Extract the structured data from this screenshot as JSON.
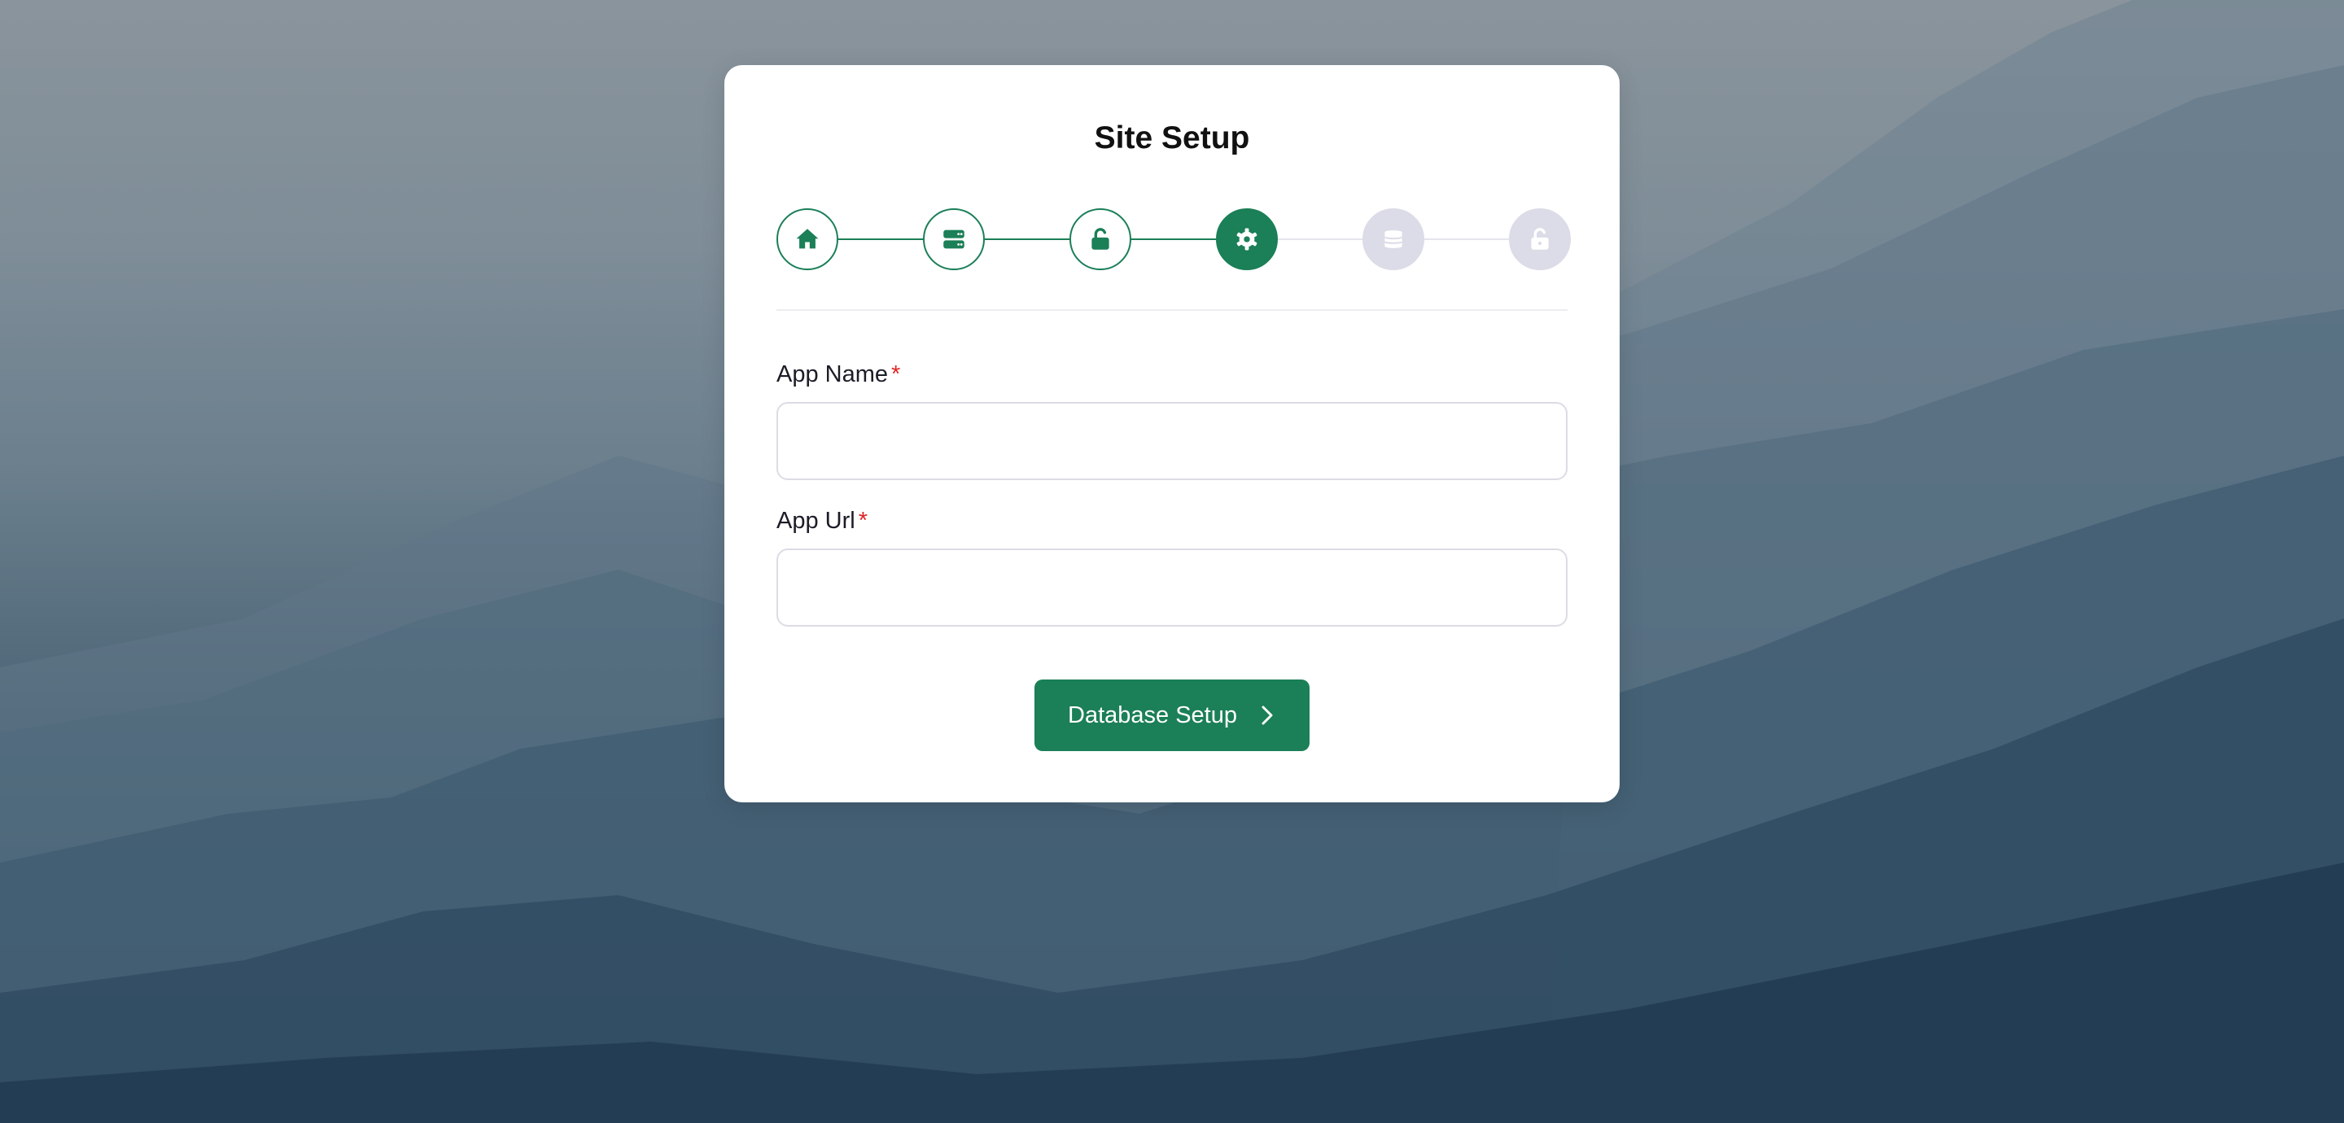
{
  "page": {
    "title": "Site Setup"
  },
  "stepper": {
    "steps": [
      {
        "icon": "home-icon",
        "state": "completed"
      },
      {
        "icon": "server-icon",
        "state": "completed"
      },
      {
        "icon": "unlock-icon",
        "state": "completed"
      },
      {
        "icon": "gear-icon",
        "state": "active"
      },
      {
        "icon": "database-icon",
        "state": "pending"
      },
      {
        "icon": "unlock-icon",
        "state": "pending"
      }
    ]
  },
  "form": {
    "app_name": {
      "label": "App Name",
      "required_mark": "*",
      "value": "",
      "placeholder": ""
    },
    "app_url": {
      "label": "App Url",
      "required_mark": "*",
      "value": "",
      "placeholder": ""
    }
  },
  "actions": {
    "next_label": "Database Setup",
    "next_icon": "chevron-right-icon"
  },
  "colors": {
    "accent": "#1b7f57",
    "pending_step": "#dcdce8",
    "required": "#e02424"
  }
}
